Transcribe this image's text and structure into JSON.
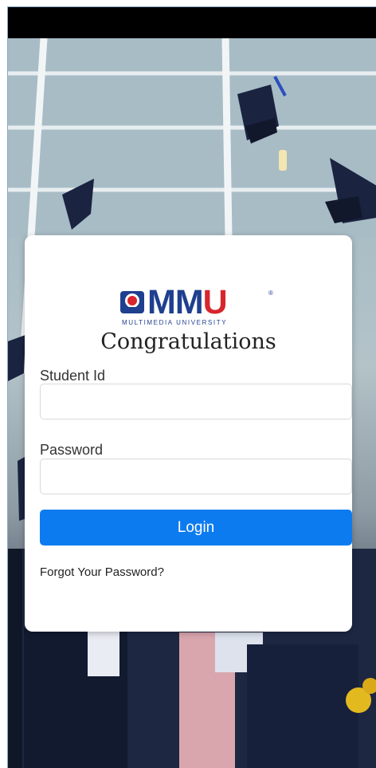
{
  "brand": {
    "logo_text_mm": "MM",
    "logo_text_u": "U",
    "registered": "®",
    "subtitle": "MULTIMEDIA UNIVERSITY",
    "color_blue": "#1f3f8f",
    "color_red": "#d7262e"
  },
  "login": {
    "title": "Congratulations",
    "student_id_label": "Student Id",
    "student_id_value": "",
    "password_label": "Password",
    "password_value": "",
    "login_button": "Login",
    "forgot_link": "Forgot Your Password?",
    "button_color": "#0d7bf0"
  }
}
